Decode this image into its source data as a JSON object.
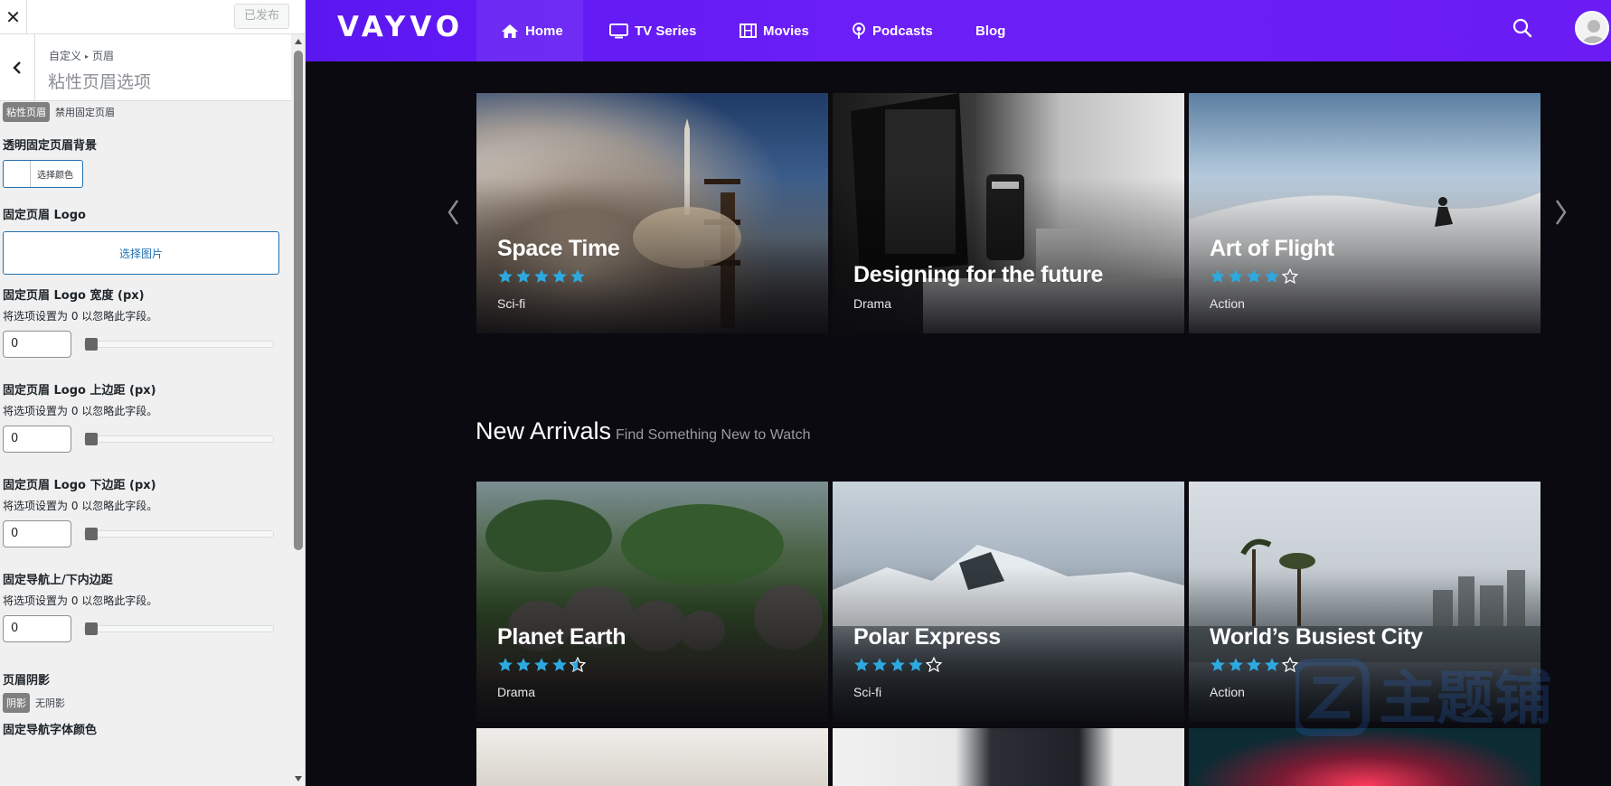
{
  "panel": {
    "close_glyph": "✕",
    "publish_label": "已发布",
    "breadcrumb_parent": "自定义",
    "breadcrumb_child": "页眉",
    "section_title": "粘性页眉选项",
    "sticky_on": "粘性页眉",
    "sticky_off": "禁用固定页眉",
    "bg_label": "透明固定页眉背景",
    "color_btn": "选择颜色",
    "logo_label": "固定页眉 Logo",
    "select_image": "选择图片",
    "fields": [
      {
        "label": "固定页眉 Logo 宽度 (px)",
        "desc": "将选项设置为 0 以忽略此字段。",
        "value": "0"
      },
      {
        "label": "固定页眉 Logo 上边距 (px)",
        "desc": "将选项设置为 0 以忽略此字段。",
        "value": "0"
      },
      {
        "label": "固定页眉 Logo 下边距 (px)",
        "desc": "将选项设置为 0 以忽略此字段。",
        "value": "0"
      },
      {
        "label": "固定导航上/下内边距",
        "desc": "将选项设置为 0 以忽略此字段。",
        "value": "0"
      }
    ],
    "shadow_label": "页眉阴影",
    "shadow_on": "阴影",
    "shadow_off": "无阴影",
    "nav_font_color": "固定导航字体颜色"
  },
  "site": {
    "logo": "VAYVO",
    "nav": [
      {
        "label": "Home",
        "icon": "home-icon",
        "active": true
      },
      {
        "label": "TV Series",
        "icon": "tv-icon"
      },
      {
        "label": "Movies",
        "icon": "film-icon"
      },
      {
        "label": "Podcasts",
        "icon": "podcast-icon"
      },
      {
        "label": "Blog"
      }
    ],
    "colors": {
      "nav": "#6a1cf3",
      "star": "#2ea9df",
      "background": "#0b0a10"
    },
    "featured": [
      {
        "title": "Space Time",
        "rating": 5,
        "genre": "Sci-fi"
      },
      {
        "title": "Designing for the future",
        "rating": null,
        "genre": "Drama"
      },
      {
        "title": "Art of Flight",
        "rating": 4,
        "genre": "Action"
      }
    ],
    "new_arrivals": {
      "title": "New Arrivals",
      "subtitle": "Find Something New to Watch",
      "items": [
        {
          "title": "Planet Earth",
          "rating": 4.5,
          "genre": "Drama"
        },
        {
          "title": "Polar Express",
          "rating": 4,
          "genre": "Sci-fi"
        },
        {
          "title": "World’s Busiest City",
          "rating": 4,
          "genre": "Action"
        }
      ]
    },
    "watermark_text": "主题铺"
  }
}
